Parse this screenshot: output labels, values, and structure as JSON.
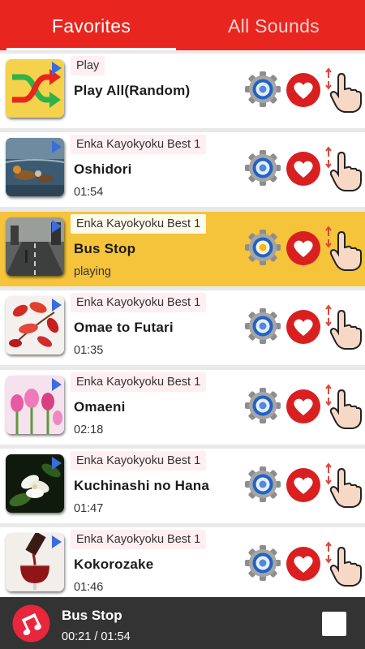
{
  "tabs": [
    {
      "label": "Favorites",
      "active": true
    },
    {
      "label": "All Sounds",
      "active": false
    }
  ],
  "colors": {
    "accent": "#e8261f",
    "playing_row": "#f5c43a",
    "player_bar": "#333333"
  },
  "list": {
    "items": [
      {
        "album": "Play",
        "title": "Play All(Random)",
        "time": "",
        "thumb": "shuffle-icon"
      },
      {
        "album": "Enka Kayokyoku Best 1",
        "title": "Oshidori",
        "time": "01:54",
        "thumb": "ducks-image"
      },
      {
        "album": "Enka Kayokyoku Best 1",
        "title": "Bus Stop",
        "time": "playing",
        "thumb": "street-image"
      },
      {
        "album": "Enka Kayokyoku Best 1",
        "title": "Omae to Futari",
        "time": "01:35",
        "thumb": "red-leaves-image"
      },
      {
        "album": "Enka Kayokyoku Best 1",
        "title": "Omaeni",
        "time": "02:18",
        "thumb": "tulips-image"
      },
      {
        "album": "Enka Kayokyoku Best 1",
        "title": "Kuchinashi no Hana",
        "time": "01:47",
        "thumb": "gardenia-image"
      },
      {
        "album": "Enka Kayokyoku Best 1",
        "title": "Kokorozake",
        "time": "01:46",
        "thumb": "wine-image"
      }
    ],
    "playing_index": 2
  },
  "player": {
    "title": "Bus Stop",
    "time": "00:21 / 01:54"
  },
  "icons": {
    "settings": "gear-icon",
    "favorite": "heart-icon",
    "reorder": "drag-hand-icon",
    "stop": "stop-icon",
    "player": "music-note-icon"
  }
}
